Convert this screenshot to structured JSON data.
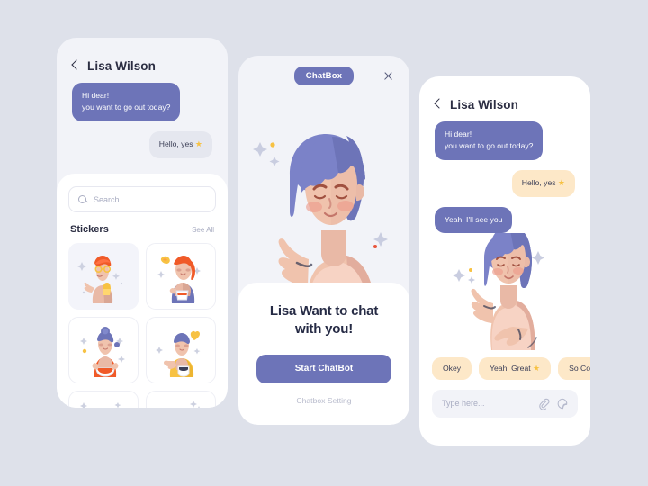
{
  "theme": {
    "background": "#dee1ea",
    "accent": "#6d74b8",
    "peach": "#fde8c8",
    "gray_bubble": "#e5e7ef",
    "text_dark": "#2b2d42",
    "muted": "#a9adc2",
    "star_yellow": "#f7c243",
    "card_white": "#ffffff",
    "phone_bg": "#f2f3f8"
  },
  "phone_one": {
    "header": {
      "back_icon": "chevron-left-icon",
      "title": "Lisa Wilson"
    },
    "messages": [
      {
        "from": "them",
        "text": "Hi dear!\nyou want to go out today?",
        "lines": [
          "Hi dear!",
          "you want to go out today?"
        ]
      },
      {
        "from": "me",
        "text": "Hello, yes",
        "star": "★",
        "style": "gray"
      }
    ],
    "sheet": {
      "search": {
        "icon": "search-icon",
        "placeholder": "Search",
        "value": ""
      },
      "section_title": "Stickers",
      "see_all": "See All",
      "stickers": [
        {
          "name": "sticker-boy-glasses-snack",
          "selected": true
        },
        {
          "name": "sticker-girl-ponytail-cup",
          "selected": false
        },
        {
          "name": "sticker-girl-bun-bowl",
          "selected": false
        },
        {
          "name": "sticker-boy-yellow-coffee",
          "selected": false
        },
        {
          "name": "sticker-row-three-left",
          "selected": false
        },
        {
          "name": "sticker-row-three-right",
          "selected": false
        }
      ]
    }
  },
  "phone_two": {
    "header": {
      "chip_label": "ChatBox",
      "close_icon": "close-icon"
    },
    "illustration": "woman-waving-illustration",
    "cta": {
      "title_line_1": "Lisa Want to chat",
      "title_line_2": "with you!",
      "button_label": "Start ChatBot",
      "link_label": "Chatbox Setting"
    }
  },
  "phone_three": {
    "header": {
      "back_icon": "chevron-left-icon",
      "title": "Lisa Wilson"
    },
    "messages": [
      {
        "from": "them",
        "lines": [
          "Hi dear!",
          "you want to go out today?"
        ]
      },
      {
        "from": "me",
        "text": "Hello, yes",
        "star": "★",
        "style": "peach"
      },
      {
        "from": "them",
        "lines": [
          "Yeah! I'll see you"
        ]
      }
    ],
    "illustration": "woman-waving-illustration",
    "quick_replies": [
      {
        "label": "Okey",
        "star": ""
      },
      {
        "label": "Yeah, Great",
        "star": "★"
      },
      {
        "label": "So Cool",
        "star": ""
      }
    ],
    "input": {
      "placeholder": "Type here...",
      "value": "",
      "attach_icon": "paperclip-icon",
      "sticker_icon": "sticker-smiley-icon"
    }
  }
}
